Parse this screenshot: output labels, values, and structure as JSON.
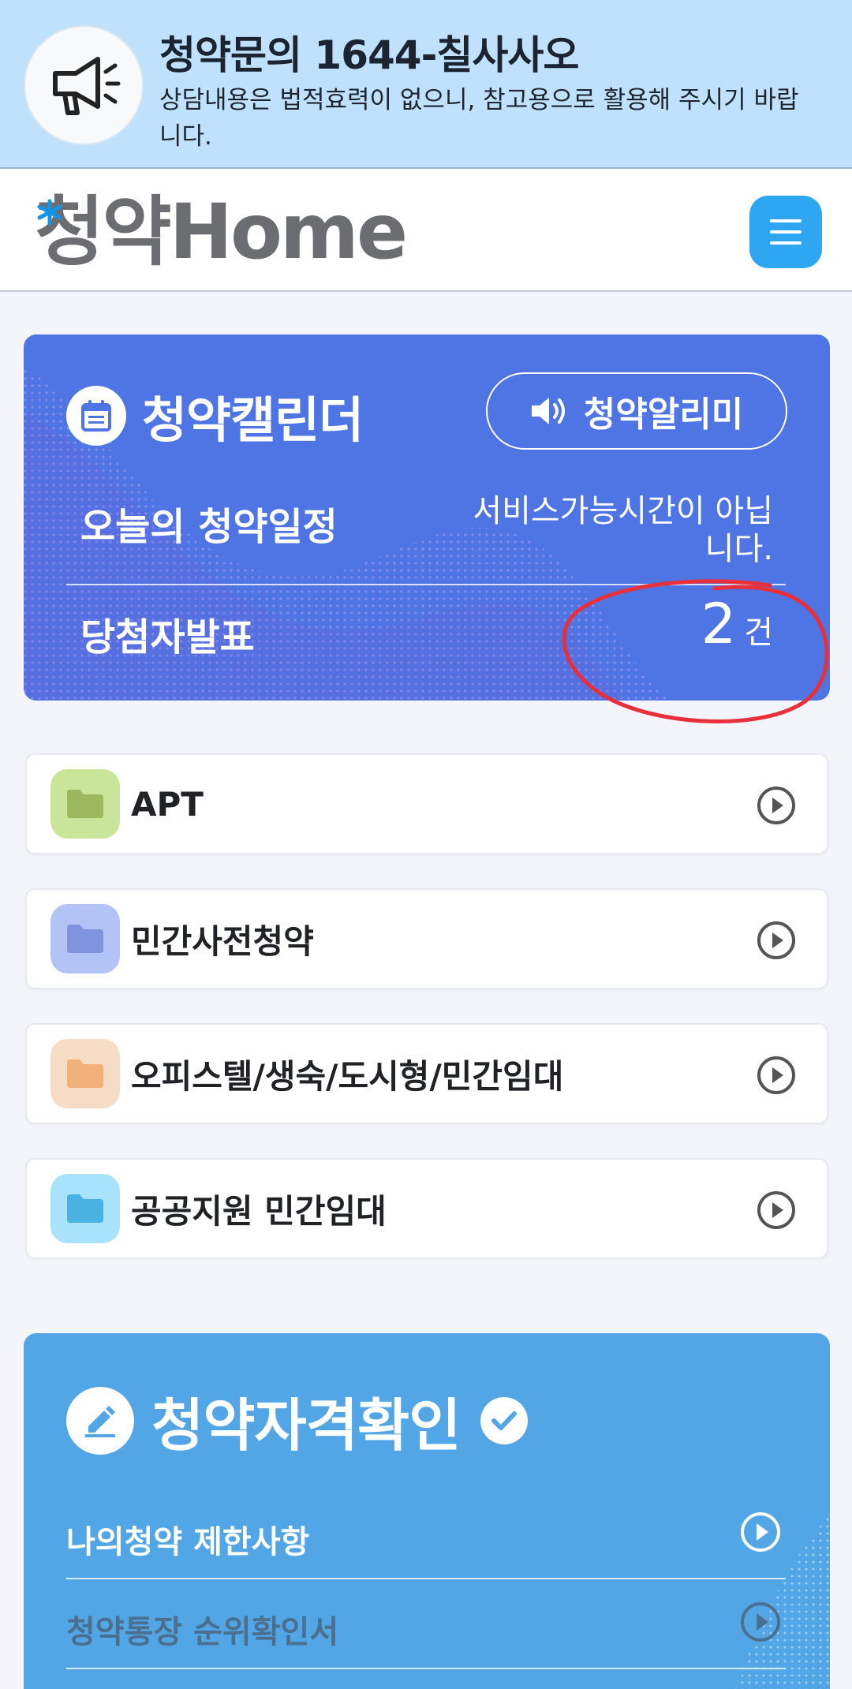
{
  "banner": {
    "title": "청약문의 1644-칠사사오",
    "text": "상담내용은 법적효력이 없으니, 참고용으로 활용해 주시기 바랍니다."
  },
  "header": {
    "logo_text": "청약Home",
    "menu_icon": "hamburger-icon"
  },
  "calendar": {
    "title": "청약캘린더",
    "alarm_label": "청약알리미",
    "today_label": "오늘의 청약일정",
    "today_status": "서비스가능시간이 아닙니다.",
    "winner_label": "당첨자발표",
    "winner_count": "2",
    "winner_unit": "건"
  },
  "list": [
    {
      "label": "APT",
      "color": "#c9e59a",
      "folder_color": "#9bb85e"
    },
    {
      "label": "민간사전청약",
      "color": "#b3c3f5",
      "folder_color": "#7f93df"
    },
    {
      "label": "오피스텔/생숙/도시형/민간임대",
      "color": "#f6dcc4",
      "folder_color": "#f2b07a"
    },
    {
      "label": "공공지원 민간임대",
      "color": "#a9e3fb",
      "folder_color": "#4ab2e3"
    }
  ],
  "eligibility": {
    "title": "청약자격확인",
    "rows": [
      {
        "label": "나의청약 제한사항",
        "color": "#ffffff"
      },
      {
        "label": "청약통장 순위확인서",
        "color": "#4a6f8f"
      }
    ]
  },
  "colors": {
    "banner_bg": "#bfe1fb",
    "calendar_bg": "#4f74e3",
    "eligibility_bg": "#52a6e6",
    "menu_button": "#2ea6f2",
    "annotation": "#e8303c"
  }
}
